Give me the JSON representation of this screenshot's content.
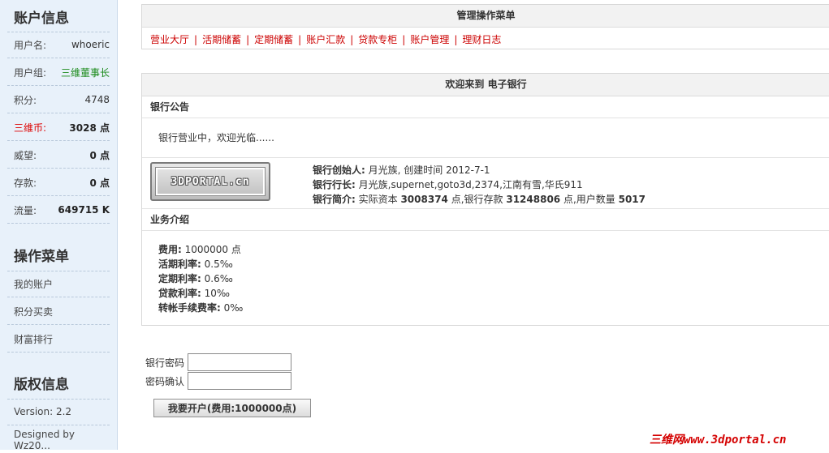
{
  "sidebar": {
    "account_header": "账户信息",
    "user_rows": [
      {
        "key": "用户名:",
        "value": "whoeric"
      },
      {
        "key": "用户组:",
        "value": "三维董事长"
      },
      {
        "key": "积分:",
        "value": "4748"
      },
      {
        "key": "三维币:",
        "value": "3028 点"
      },
      {
        "key": "威望:",
        "value": "0 点"
      },
      {
        "key": "存款:",
        "value": "0 点"
      },
      {
        "key": "流量:",
        "value": "649715 K"
      }
    ],
    "menu_header": "操作菜单",
    "menu_items": [
      "我的账户",
      "积分买卖",
      "财富排行"
    ],
    "copyright_header": "版权信息",
    "version": "Version: 2.2",
    "designed_by": "Designed by Wz20..."
  },
  "admin_menu": {
    "title": "管理操作菜单",
    "links": [
      "营业大厅",
      "活期储蓄",
      "定期储蓄",
      "账户汇款",
      "贷款专柜",
      "账户管理",
      "理财日志"
    ]
  },
  "bank": {
    "welcome_title": "欢迎来到 电子银行",
    "notice_title": "银行公告",
    "notice_text": "银行营业中，欢迎光临......",
    "logo_text": "3DPORTAL.cn",
    "founder_label": "银行创始人:",
    "founder_value": " 月光族, 创建时间 2012-7-1",
    "president_label": "银行行长:",
    "president_value": " 月光族,supernet,goto3d,2374,江南有雪,华氏911",
    "intro_label": "银行简介:",
    "intro_part1": " 实际资本 ",
    "capital": "3008374",
    "intro_part2": " 点,银行存款 ",
    "deposits": "31248806",
    "intro_part3": " 点,用户数量 ",
    "users": "5017",
    "biz_title": "业务介绍",
    "biz_items": [
      {
        "label": "费用:",
        "value": " 1000000 点"
      },
      {
        "label": "活期利率:",
        "value": " 0.5‰"
      },
      {
        "label": "定期利率:",
        "value": " 0.6‰"
      },
      {
        "label": "贷款利率:",
        "value": " 10‰"
      },
      {
        "label": "转帐手续费率:",
        "value": " 0‰"
      }
    ]
  },
  "form": {
    "password_label": "银行密码",
    "password_value": "",
    "confirm_label": "密码确认",
    "confirm_value": "",
    "open_button": "我要开户(费用:1000000点)"
  },
  "watermark": "三维网www.3dportal.cn"
}
